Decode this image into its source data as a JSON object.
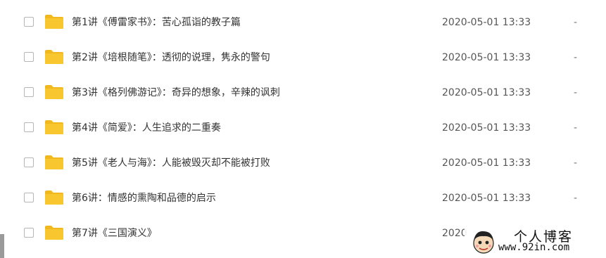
{
  "files": [
    {
      "name": "第1讲《傅雷家书》：苦心孤诣的教子篇",
      "modified": "2020-05-01 13:33",
      "size": "-"
    },
    {
      "name": "第2讲《培根随笔》：透彻的说理，隽永的警句",
      "modified": "2020-05-01 13:33",
      "size": "-"
    },
    {
      "name": "第3讲《格列佛游记》：奇异的想象，辛辣的讽刺",
      "modified": "2020-05-01 13:33",
      "size": "-"
    },
    {
      "name": "第4讲《简爱》：人生追求的二重奏",
      "modified": "2020-05-01 13:33",
      "size": "-"
    },
    {
      "name": "第5讲《老人与海》：人能被毁灭却不能被打败",
      "modified": "2020-05-01 13:33",
      "size": "-"
    },
    {
      "name": "第6讲：情感的熏陶和品德的启示",
      "modified": "2020-05-01 13:33",
      "size": "-"
    },
    {
      "name": "第7讲《三国演义》",
      "modified": "2020",
      "size": ""
    }
  ],
  "watermark": {
    "title": "个人博客",
    "url": "www.92in.com"
  },
  "colors": {
    "folder": "#F8C72F",
    "folder_tab": "#F0B81E",
    "text": "#333333",
    "muted": "#555555"
  }
}
